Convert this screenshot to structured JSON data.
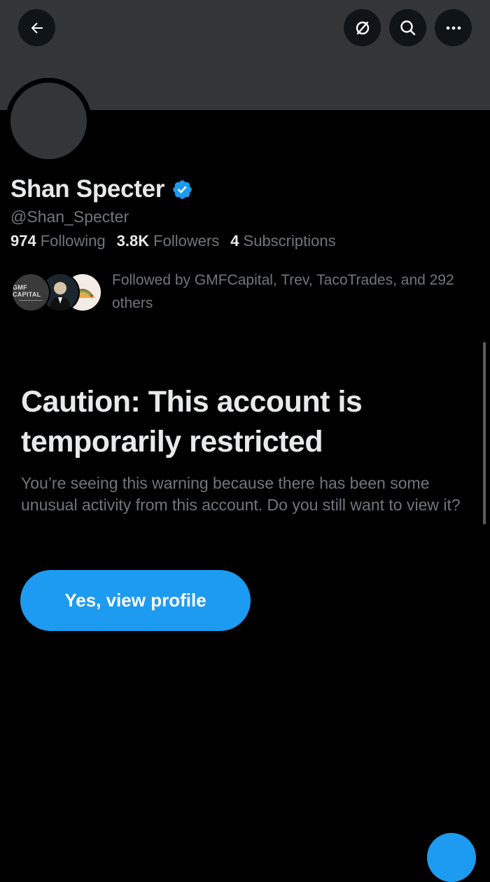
{
  "header": {
    "back_icon": "arrow-left-icon",
    "grok_icon": "grok-icon",
    "search_icon": "search-icon",
    "more_icon": "more-horizontal-icon"
  },
  "profile": {
    "name": "Shan Specter",
    "verified": true,
    "handle": "@Shan_Specter",
    "following_count": "974",
    "following_label": "Following",
    "followers_count": "3.8K",
    "followers_label": "Followers",
    "subscriptions_count": "4",
    "subscriptions_label": "Subscriptions",
    "followed_by_text": "Followed by GMFCapital, Trev, TacoTrades, and 292 others",
    "follower_avatar_1_text": "GMF CAPITAL"
  },
  "restriction": {
    "title": "Caution: This account is temporarily restricted",
    "message": "You’re seeing this warning because there has been some unusual activity from this account. Do you still want to view it?",
    "button_label": "Yes, view profile"
  },
  "colors": {
    "accent": "#1d9bf0",
    "background": "#000000",
    "banner": "#333639",
    "secondary_text": "#71767b",
    "primary_text": "#e7e9ea"
  }
}
